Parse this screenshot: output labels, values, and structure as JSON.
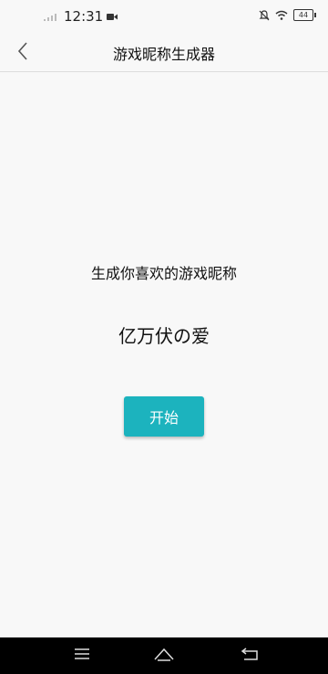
{
  "status_bar": {
    "time": "12:31",
    "battery_level": "44",
    "icons": [
      "signal-icon",
      "video-icon",
      "notification-off-icon",
      "wifi-icon",
      "battery-icon"
    ]
  },
  "toolbar": {
    "title": "游戏昵称生成器",
    "back_icon": "chevron-left-icon"
  },
  "main": {
    "prompt": "生成你喜欢的游戏昵称",
    "nickname": "亿万伏の爱",
    "start_label": "开始"
  },
  "colors": {
    "accent": "#1cb3be",
    "background": "#f8f8f8",
    "nav_bar": "#000000"
  },
  "nav_bar": {
    "icons": [
      "menu-icon",
      "home-icon",
      "back-icon"
    ]
  }
}
